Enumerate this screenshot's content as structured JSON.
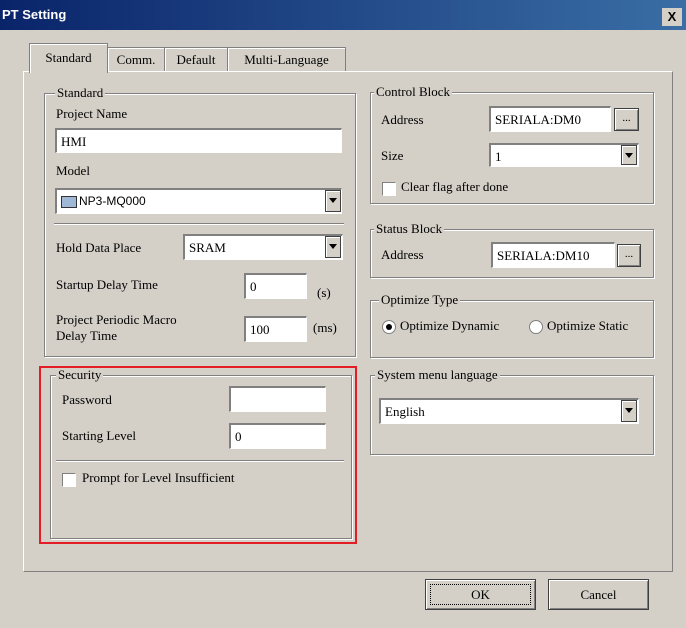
{
  "window": {
    "title": "PT Setting",
    "close_glyph": "X"
  },
  "tabs": [
    {
      "label": "Standard"
    },
    {
      "label": "Comm."
    },
    {
      "label": "Default"
    },
    {
      "label": "Multi-Language"
    }
  ],
  "standard": {
    "legend": "Standard",
    "project_name_label": "Project Name",
    "project_name_value": "HMI",
    "model_label": "Model",
    "model_value": "NP3-MQ000",
    "hold_data_label": "Hold Data Place",
    "hold_data_value": "SRAM",
    "startup_delay_label": "Startup Delay Time",
    "startup_delay_value": "0",
    "startup_delay_unit": "(s)",
    "macro_delay_label_line1": "Project Periodic Macro",
    "macro_delay_label_line2": "Delay Time",
    "macro_delay_value": "100",
    "macro_delay_unit": "(ms)"
  },
  "security": {
    "legend": "Security",
    "password_label": "Password",
    "password_value": "",
    "starting_level_label": "Starting Level",
    "starting_level_value": "0",
    "prompt_label": "Prompt for Level Insufficient",
    "prompt_checked": false
  },
  "control_block": {
    "legend": "Control Block",
    "address_label": "Address",
    "address_value": "SERIALA:DM0",
    "browse_label": "...",
    "size_label": "Size",
    "size_value": "1",
    "clear_flag_label": "Clear flag after done",
    "clear_flag_checked": false
  },
  "status_block": {
    "legend": "Status Block",
    "address_label": "Address",
    "address_value": "SERIALA:DM10",
    "browse_label": "..."
  },
  "optimize": {
    "legend": "Optimize Type",
    "dynamic_label": "Optimize Dynamic",
    "static_label": "Optimize Static",
    "selected": "Optimize Dynamic"
  },
  "system_menu": {
    "legend": "System menu language",
    "value": "English"
  },
  "buttons": {
    "ok": "OK",
    "cancel": "Cancel"
  },
  "colors": {
    "highlight": "#e41e26",
    "titlebar": "#0a246a",
    "face": "#d4d0c8"
  }
}
